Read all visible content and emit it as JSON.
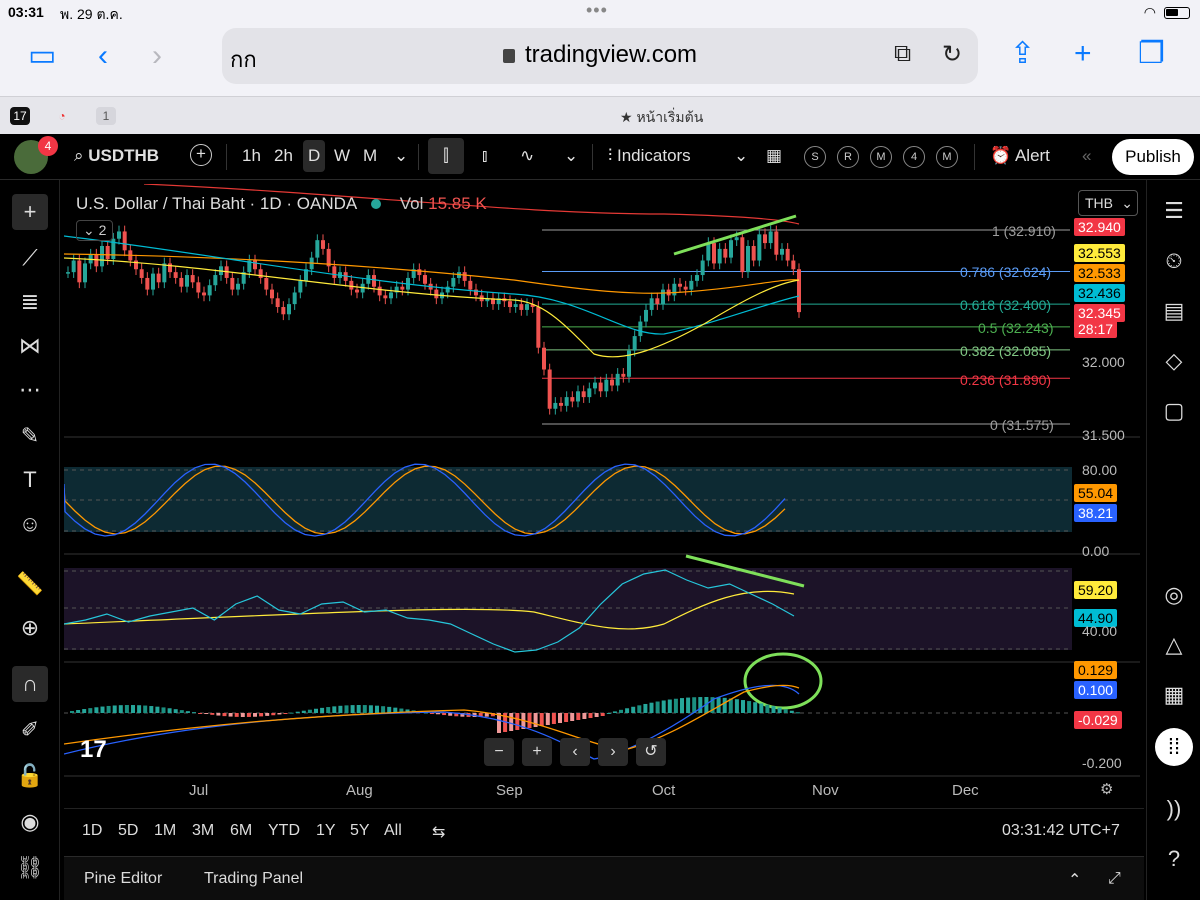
{
  "status_bar": {
    "time": "03:31",
    "date": "พ. 29 ต.ค.",
    "battery": ""
  },
  "browser": {
    "reader_text": "กก",
    "url": "tradingview.com",
    "tab_title": "หน้าเริ่มต้น",
    "tab_count": "1"
  },
  "tv_toolbar": {
    "symbol": "USDTHB",
    "avatar_badge": "4",
    "intervals": [
      "1h",
      "2h",
      "D",
      "W",
      "M"
    ],
    "active_interval": "D",
    "indicators_label": "Indicators",
    "alert_label": "Alert",
    "publish_label": "Publish",
    "layout_buttons": [
      "S",
      "R",
      "M",
      "4",
      "M"
    ]
  },
  "legend": {
    "title": "U.S. Dollar / Thai Baht · 1D · OANDA",
    "vol_label": "Vol",
    "vol_value": "15.85 K",
    "collapse_count": "2",
    "currency": "THB"
  },
  "fib_levels": [
    {
      "label": "1 (32.910)",
      "value": 32.91,
      "color": "#9e9e9e"
    },
    {
      "label": "0.786 (32.624)",
      "value": 32.624,
      "color": "#5b9cf6"
    },
    {
      "label": "0.618 (32.400)",
      "value": 32.4,
      "color": "#22ab94"
    },
    {
      "label": "0.5 (32.243)",
      "value": 32.243,
      "color": "#4caf50"
    },
    {
      "label": "0.382 (32.085)",
      "value": 32.085,
      "color": "#81c784"
    },
    {
      "label": "0.236 (31.890)",
      "value": 31.89,
      "color": "#f23645"
    },
    {
      "label": "0 (31.575)",
      "value": 31.575,
      "color": "#9e9e9e"
    }
  ],
  "price_tags": [
    {
      "text": "32.940",
      "bg": "#f23645",
      "fg": "#ffffff"
    },
    {
      "text": "32.553",
      "bg": "#ffeb3b",
      "fg": "#000000"
    },
    {
      "text": "32.533",
      "bg": "#ff9800",
      "fg": "#000000"
    },
    {
      "text": "32.436",
      "bg": "#00bcd4",
      "fg": "#000000"
    },
    {
      "text": "32.345",
      "bg": "#f23645",
      "fg": "#ffffff"
    },
    {
      "text": "28:17",
      "bg": "#f23645",
      "fg": "#ffffff"
    }
  ],
  "price_axis": [
    "32.000",
    "31.500"
  ],
  "stoch": {
    "axis": [
      "80.00",
      "0.00"
    ],
    "tags": [
      {
        "text": "55.04",
        "bg": "#ff9800"
      },
      {
        "text": "38.21",
        "bg": "#2962ff"
      }
    ]
  },
  "rsi": {
    "axis": [
      "40.00"
    ],
    "tags": [
      {
        "text": "59.20",
        "bg": "#ffeb3b"
      },
      {
        "text": "44.90",
        "bg": "#00bcd4"
      }
    ]
  },
  "macd": {
    "axis": [
      "-0.200"
    ],
    "tags": [
      {
        "text": "0.129",
        "bg": "#ff9800"
      },
      {
        "text": "0.100",
        "bg": "#2962ff"
      },
      {
        "text": "-0.029",
        "bg": "#f23645"
      }
    ]
  },
  "time_axis": [
    "Jul",
    "Aug",
    "Sep",
    "Oct",
    "Nov",
    "Dec"
  ],
  "ranges": [
    "1D",
    "5D",
    "1M",
    "3M",
    "6M",
    "YTD",
    "1Y",
    "5Y",
    "All"
  ],
  "clock": "03:31:42 UTC+7",
  "bottom_tabs": [
    "Pine Editor",
    "Trading Panel"
  ],
  "colors": {
    "up": "#26a69a",
    "down": "#ef5350",
    "accent": "#2962ff"
  }
}
